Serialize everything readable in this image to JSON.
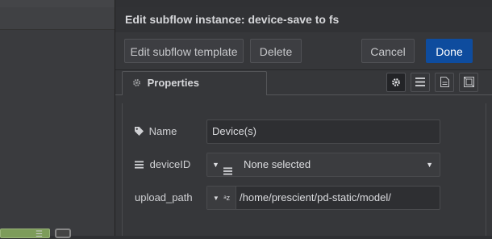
{
  "tray": {
    "title": "Edit subflow instance: device-save to fs",
    "edit_template_label": "Edit subflow template",
    "delete_label": "Delete",
    "cancel_label": "Cancel",
    "done_label": "Done"
  },
  "tabs": {
    "properties_label": "Properties"
  },
  "form": {
    "name_label": "Name",
    "name_value": "Device(s)",
    "deviceid_label": "deviceID",
    "deviceid_value": "None selected",
    "upload_path_label": "upload_path",
    "upload_path_value": "/home/prescient/pd-static/model/"
  },
  "icons": [
    "tag-icon",
    "list-icon",
    "gear-icon",
    "description-icon",
    "appearance-icon",
    "string-type-icon",
    "caret-down-icon"
  ],
  "colors": {
    "done_button": "#0e4c9e",
    "node_green": "#7d9c5a"
  }
}
